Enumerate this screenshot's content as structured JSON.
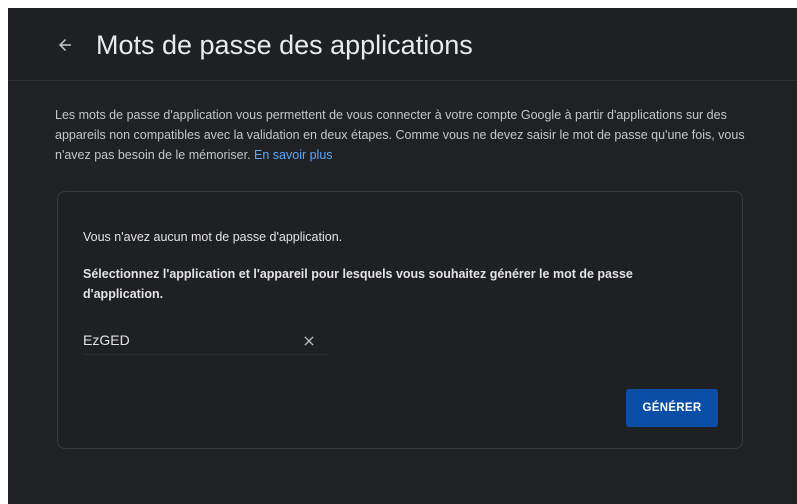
{
  "header": {
    "title": "Mots de passe des applications"
  },
  "intro": {
    "text": "Les mots de passe d'application vous permettent de vous connecter à votre compte Google à partir d'applications sur des appareils non compatibles avec la validation en deux étapes. Comme vous ne devez saisir le mot de passe qu'une fois, vous n'avez pas besoin de le mémoriser.",
    "learn_more": "En savoir plus"
  },
  "card": {
    "empty_message": "Vous n'avez aucun mot de passe d'application.",
    "instruction": "Sélectionnez l'application et l'appareil pour lesquels vous souhaitez générer le mot de passe d'application.",
    "app_name_value": "EzGED",
    "generate_label": "GÉNÉRER"
  },
  "icons": {
    "back": "arrow-left-icon",
    "clear": "close-icon"
  },
  "colors": {
    "background": "#202124",
    "text": "#e3e3e3",
    "link": "#5aa7ff",
    "primary_button": "#0b4ea8"
  }
}
